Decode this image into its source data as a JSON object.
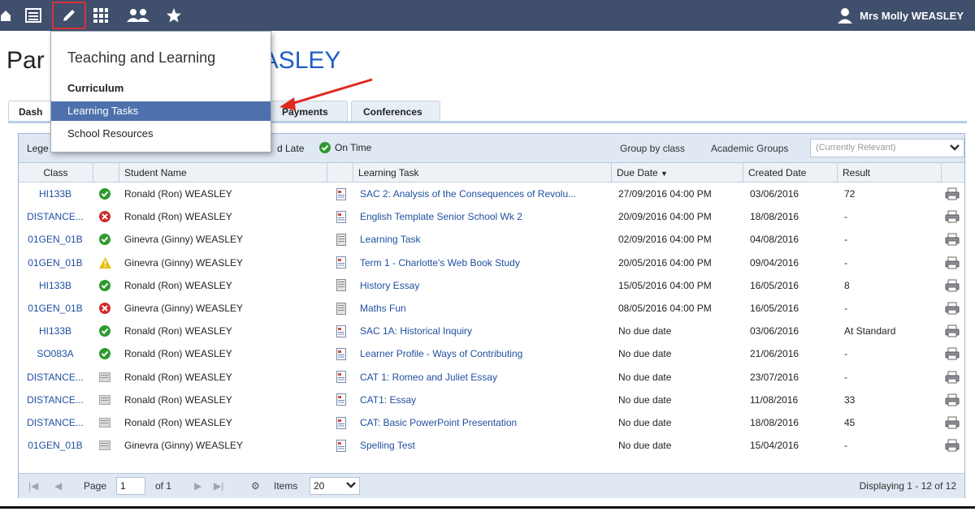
{
  "topbar": {
    "icons": [
      "home-icon",
      "calendar-icon",
      "pencil-icon",
      "grid-icon",
      "people-icon",
      "star-icon"
    ],
    "user_name": "Mrs Molly WEASLEY",
    "background": "#3f4f6c"
  },
  "page": {
    "title_prefix": "Par",
    "title_name": "ASLEY"
  },
  "tabs": [
    {
      "label": "Dash"
    },
    {
      "label": "Payments"
    },
    {
      "label": "Conferences"
    }
  ],
  "menu": {
    "title": "Teaching and Learning",
    "section": "Curriculum",
    "items": [
      {
        "label": "Learning Tasks",
        "selected": true
      },
      {
        "label": "School Resources",
        "selected": false
      }
    ]
  },
  "legend": {
    "label": "Lege",
    "late": "d Late",
    "on_time": "On Time",
    "group_by": "Group by class",
    "academic_groups": "Academic Groups",
    "academic_placeholder": "(Currently Relevant)"
  },
  "columns": {
    "class": "Class",
    "student": "Student Name",
    "task": "Learning Task",
    "due": "Due Date",
    "created": "Created Date",
    "result": "Result"
  },
  "rows": [
    {
      "class": "HI133B",
      "status": "ok",
      "student": "Ronald (Ron) WEASLEY",
      "task_icon": "doc-color",
      "task": "SAC 2: Analysis of the Consequences of Revolu...",
      "due": "27/09/2016 04:00 PM",
      "created": "03/06/2016",
      "result": "72"
    },
    {
      "class": "DISTANCE...",
      "status": "late",
      "student": "Ronald (Ron) WEASLEY",
      "task_icon": "doc-color",
      "task": "English Template Senior School Wk 2",
      "due": "20/09/2016 04:00 PM",
      "created": "18/08/2016",
      "result": "-"
    },
    {
      "class": "01GEN_01B",
      "status": "ok",
      "student": "Ginevra (Ginny) WEASLEY",
      "task_icon": "doc-grey",
      "task": "Learning Task",
      "due": "02/09/2016 04:00 PM",
      "created": "04/08/2016",
      "result": "-"
    },
    {
      "class": "01GEN_01B",
      "status": "warn",
      "student": "Ginevra (Ginny) WEASLEY",
      "task_icon": "doc-color",
      "task": "Term 1 - Charlotte's Web Book Study",
      "due": "20/05/2016 04:00 PM",
      "created": "09/04/2016",
      "result": "-"
    },
    {
      "class": "HI133B",
      "status": "ok",
      "student": "Ronald (Ron) WEASLEY",
      "task_icon": "doc-grey",
      "task": "History Essay",
      "due": "15/05/2016 04:00 PM",
      "created": "16/05/2016",
      "result": "8"
    },
    {
      "class": "01GEN_01B",
      "status": "late",
      "student": "Ginevra (Ginny) WEASLEY",
      "task_icon": "doc-grey",
      "task": "Maths Fun",
      "due": "08/05/2016 04:00 PM",
      "created": "16/05/2016",
      "result": "-"
    },
    {
      "class": "HI133B",
      "status": "ok",
      "student": "Ronald (Ron) WEASLEY",
      "task_icon": "doc-color",
      "task": "SAC 1A: Historical Inquiry",
      "due": "No due date",
      "created": "03/06/2016",
      "result": "At Standard"
    },
    {
      "class": "SO083A",
      "status": "ok",
      "student": "Ronald (Ron) WEASLEY",
      "task_icon": "doc-color",
      "task": "Learner Profile - Ways of Contributing",
      "due": "No due date",
      "created": "21/06/2016",
      "result": "-"
    },
    {
      "class": "DISTANCE...",
      "status": "none",
      "student": "Ronald (Ron) WEASLEY",
      "task_icon": "doc-color",
      "task": "CAT 1: Romeo and Juliet Essay",
      "due": "No due date",
      "created": "23/07/2016",
      "result": "-"
    },
    {
      "class": "DISTANCE...",
      "status": "none",
      "student": "Ronald (Ron) WEASLEY",
      "task_icon": "doc-color",
      "task": "CAT1: Essay",
      "due": "No due date",
      "created": "11/08/2016",
      "result": "33"
    },
    {
      "class": "DISTANCE...",
      "status": "none",
      "student": "Ronald (Ron) WEASLEY",
      "task_icon": "doc-color",
      "task": "CAT: Basic PowerPoint Presentation",
      "due": "No due date",
      "created": "18/08/2016",
      "result": "45"
    },
    {
      "class": "01GEN_01B",
      "status": "none",
      "student": "Ginevra (Ginny) WEASLEY",
      "task_icon": "doc-color",
      "task": "Spelling Test",
      "due": "No due date",
      "created": "15/04/2016",
      "result": "-"
    }
  ],
  "pager": {
    "page_label": "Page",
    "page_value": "1",
    "of_label": "of 1",
    "items_label": "Items",
    "items_value": "20",
    "displaying": "Displaying 1 - 12 of 12"
  },
  "colors": {
    "ok": "#2e9a2e",
    "late": "#d02a2a",
    "warn": "#e8c010",
    "accent": "#4e71ad",
    "arrow": "#e0281f"
  }
}
